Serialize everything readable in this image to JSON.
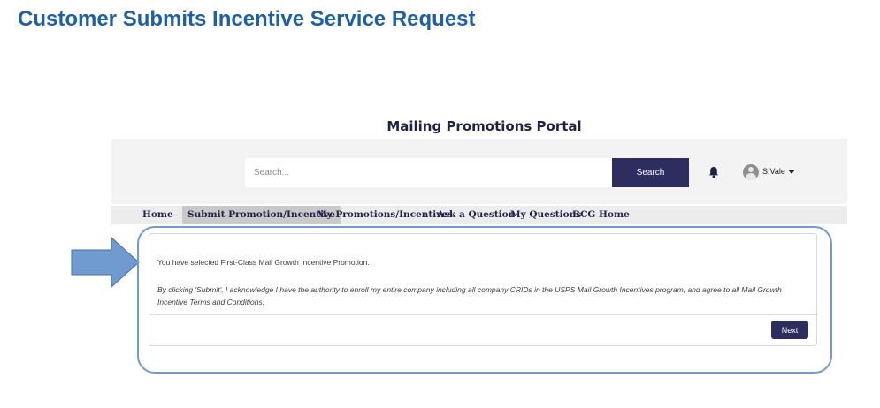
{
  "slide": {
    "title": "Customer Submits Incentive Service Request"
  },
  "portal": {
    "title": "Mailing Promotions Portal"
  },
  "header": {
    "search_placeholder": "Search...",
    "search_button": "Search",
    "notification_icon": "bell-icon",
    "user": {
      "name": "S.Vale",
      "avatar_icon": "user-avatar-icon",
      "menu_icon": "caret-down-icon"
    }
  },
  "nav": {
    "items": [
      {
        "label": "Home",
        "active": false
      },
      {
        "label": "Submit Promotion/Incentive",
        "active": true
      },
      {
        "label": "My Promotions/Incentives",
        "active": false
      },
      {
        "label": "Ask a Question",
        "active": false
      },
      {
        "label": "My Questions",
        "active": false
      },
      {
        "label": "BCG Home",
        "active": false
      }
    ]
  },
  "card": {
    "selection_text": "You have selected First-Class Mail Growth Incentive Promotion.",
    "terms_text": "By clicking 'Submit', I acknowledge I have the authority to enroll my entire company including all company CRIDs in the USPS Mail Growth Incentives program, and agree to all Mail Growth Incentive Terms and Conditions.",
    "next_button": "Next"
  },
  "colors": {
    "title_blue": "#1f5fa5",
    "primary_navy": "#2d2d60",
    "arrow_fill": "#6f9bd1",
    "highlight_border": "#6f9bd1",
    "active_tab_bg": "#c9c9c9"
  }
}
